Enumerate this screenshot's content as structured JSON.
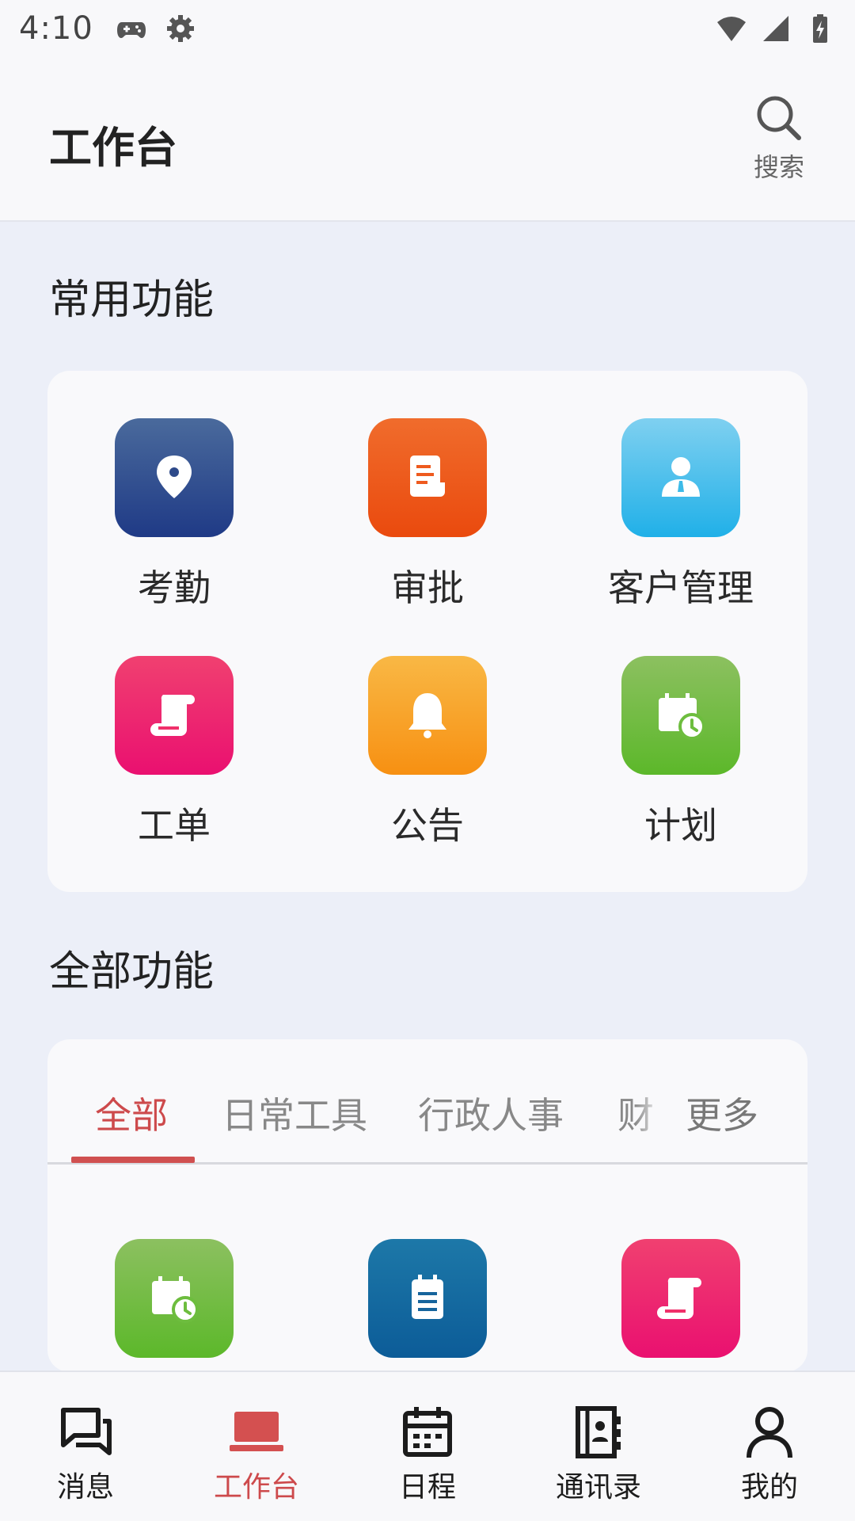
{
  "status_bar": {
    "time": "4:10",
    "icons": [
      "gamepad-icon",
      "settings-gear-icon",
      "wifi-icon",
      "cellular-signal-icon",
      "battery-charging-icon"
    ]
  },
  "header": {
    "title": "工作台",
    "search_label": "搜索"
  },
  "common": {
    "title": "常用功能",
    "items": [
      {
        "label": "考勤",
        "icon": "location-pin-icon",
        "color": "#2e4a8a"
      },
      {
        "label": "审批",
        "icon": "document-icon",
        "color": "#ee5a1e"
      },
      {
        "label": "客户管理",
        "icon": "person-icon",
        "color": "#3dbbe8"
      },
      {
        "label": "工单",
        "icon": "scroll-icon",
        "color": "#f0306a"
      },
      {
        "label": "公告",
        "icon": "bell-icon",
        "color": "#f8a223"
      },
      {
        "label": "计划",
        "icon": "calendar-clock-icon",
        "color": "#6dbd3e"
      }
    ]
  },
  "all": {
    "title": "全部功能",
    "tabs": [
      "全部",
      "日常工具",
      "行政人事",
      "财"
    ],
    "active_tab": "全部",
    "more_label": "更多",
    "items": [
      {
        "icon": "calendar-clock-icon",
        "color": "#6dbd3e"
      },
      {
        "icon": "clipboard-icon",
        "color": "#16649c"
      },
      {
        "icon": "scroll-icon",
        "color": "#f0306a"
      }
    ]
  },
  "bottom_nav": {
    "items": [
      {
        "label": "消息",
        "icon": "chat-icon"
      },
      {
        "label": "工作台",
        "icon": "laptop-icon",
        "active": true
      },
      {
        "label": "日程",
        "icon": "calendar-icon"
      },
      {
        "label": "通讯录",
        "icon": "contacts-book-icon"
      },
      {
        "label": "我的",
        "icon": "person-outline-icon"
      }
    ]
  },
  "colors": {
    "accent": "#cd4a4c",
    "background": "#eceff8"
  }
}
